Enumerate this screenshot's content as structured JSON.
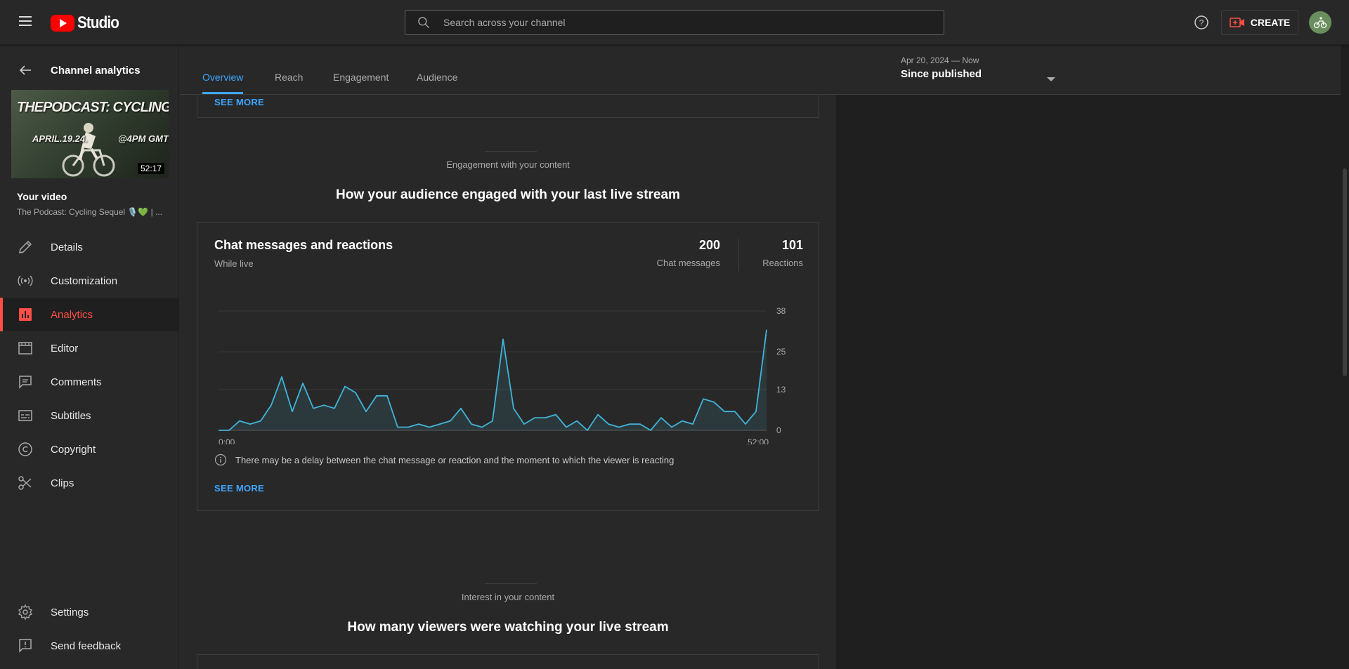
{
  "header": {
    "logo_text": "Studio",
    "search_placeholder": "Search across your channel",
    "create_label": "CREATE"
  },
  "sidebar": {
    "back_label": "Channel analytics",
    "thumbnail": {
      "title_text": "THEPODCAST: CYCLINGSEQUEL",
      "date_text": "APRIL.19.24.",
      "time_text": "@4PM GMT",
      "duration": "52:17"
    },
    "your_video_label": "Your video",
    "video_title": "The Podcast: Cycling Sequel 🎙️💚 | ...",
    "items": [
      {
        "label": "Details",
        "icon": "pencil-icon"
      },
      {
        "label": "Customization",
        "icon": "broadcast-icon"
      },
      {
        "label": "Analytics",
        "icon": "analytics-icon",
        "active": true
      },
      {
        "label": "Editor",
        "icon": "film-icon"
      },
      {
        "label": "Comments",
        "icon": "comment-icon"
      },
      {
        "label": "Subtitles",
        "icon": "subtitles-icon"
      },
      {
        "label": "Copyright",
        "icon": "copyright-icon"
      },
      {
        "label": "Clips",
        "icon": "scissors-icon"
      }
    ],
    "bottom_items": [
      {
        "label": "Settings",
        "icon": "gear-icon"
      },
      {
        "label": "Send feedback",
        "icon": "feedback-icon"
      }
    ]
  },
  "tabs": [
    "Overview",
    "Reach",
    "Engagement",
    "Audience"
  ],
  "active_tab": "Overview",
  "date_selector": {
    "range": "Apr 20, 2024 — Now",
    "period": "Since published"
  },
  "prev_card": {
    "see_more": "SEE MORE"
  },
  "engagement_section": {
    "subtitle": "Engagement with your content",
    "heading": "How your audience engaged with your last live stream"
  },
  "chat_card": {
    "title": "Chat messages and reactions",
    "subtitle": "While live",
    "metrics": [
      {
        "value": "200",
        "label": "Chat messages"
      },
      {
        "value": "101",
        "label": "Reactions"
      }
    ],
    "note": "There may be a delay between the chat message or reaction and the moment to which the viewer is reacting",
    "see_more": "SEE MORE"
  },
  "interest_section": {
    "subtitle": "Interest in your content",
    "heading": "How many viewers were watching your live stream"
  },
  "colors": {
    "accent_blue": "#3ea6ff",
    "active_red": "#ff4e45",
    "line_color": "#41b4d9",
    "brand_red": "#ff0000"
  },
  "chart_data": {
    "type": "area",
    "x_start_label": "0:00",
    "x_end_label": "52:00",
    "ylim": [
      0,
      38
    ],
    "y_ticks": [
      "38",
      "25",
      "13",
      "0"
    ],
    "y_tick_values": [
      38,
      25,
      13,
      0
    ],
    "values": [
      0,
      0,
      3,
      2,
      3,
      8,
      17,
      6,
      15,
      7,
      8,
      7,
      14,
      12,
      6,
      11,
      11,
      1,
      1,
      2,
      1,
      2,
      3,
      7,
      2,
      1,
      3,
      29,
      7,
      2,
      4,
      4,
      5,
      1,
      3,
      0,
      5,
      2,
      1,
      2,
      2,
      0,
      4,
      1,
      3,
      2,
      10,
      9,
      6,
      6,
      2,
      6,
      32
    ],
    "grid": true
  }
}
